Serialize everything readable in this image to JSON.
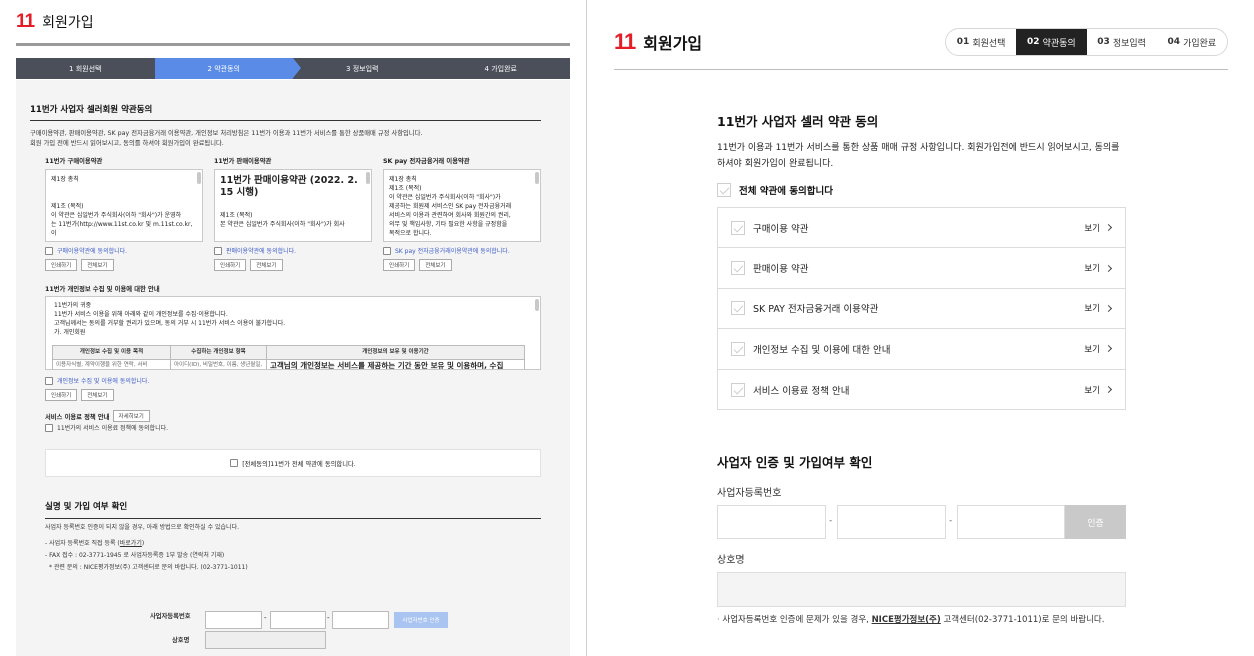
{
  "left": {
    "logo": "11",
    "title": "회원가입",
    "steps": [
      "1  회원선택",
      "2  약관동의",
      "3  정보입력",
      "4  가입완료"
    ],
    "section_title": "11번가 사업자 셀러회원 약관동의",
    "intro1": "구매이용약관, 판매이용약관, SK pay 전자금융거래 이용약관, 개인정보 처리방침은 11번가 이용과 11번가 서비스를 통한 상품매매 규정 사항입니다.",
    "intro2": "회원 가입 전에 반드시 읽어보시고, 동의를 하셔야 회원가입이 완료됩니다.",
    "terms": [
      {
        "title": "11번가 구매이용약관",
        "l1": "제1장 총칙",
        "l2": "",
        "l3": "제1조 (목적)",
        "l4": "이 약관은 십일번가 주식회사(이하 \"회사\")가 운영하",
        "l5": "는 11번가(http://www.11st.co.kr 및 m.11st.co.kr, 이",
        "chk": "구매이용약관에 동의합니다."
      },
      {
        "title": "11번가 판매이용약관",
        "big": "11번가 판매이용약관 (2022. 2. 15 시행)",
        "l3": "제1조 (목적)",
        "l4": "본 약관은 십일번가 주식회사(이하 \"회사\")가 회사",
        "chk": "판매이용약관에 동의합니다."
      },
      {
        "title": "SK pay 전자금융거래 이용약관",
        "l1": "제1장 총칙",
        "l2": "제1조 (목적)",
        "l3": "이 약관은 십일번가 주식회사(이하 \"회사\")가",
        "l4": "제공하는 회원제 서비스인 SK pay 전자금융거래",
        "l5": "서비스의 이용과 관련하여 회사와 회원간의 권리,",
        "l6": "의무 및 책임사항, 기타 필요한 사항을 규정함을",
        "l7": "목적으로 합니다.",
        "chk": "SK pay 전자금융거래이용약관에 동의합니다."
      }
    ],
    "btn_print": "인쇄하기",
    "btn_full": "전체보기",
    "priv_title": "11번가 개인정보 수집 및 이용에 대한 안내",
    "priv_l1": "11번가의 귀중",
    "priv_l2": "11번가 서비스 이용을 위해 아래와 같이 개인정보를 수집·이용합니다.",
    "priv_l3": "고객님께서는 동의를 거부할 권리가 있으며, 동의 거부 시 11번가 서비스 이용이 불가합니다.",
    "priv_l4": "가. 개인회원",
    "priv_cols": [
      "개인정보 수집 및 이용 목적",
      "수집하는 개인정보 항목",
      "개인정보의 보유 및 이용기간"
    ],
    "priv_row": [
      "이용자식별, 계약이행을 위한 연락, 서비",
      "아이디(ID), 비밀번호, 이름, 생년월일, ",
      "고객님의 개인정보는 서비스를 제공하는 기간 동안 보유 및 이용하며, 수집"
    ],
    "priv_chk": "개인정보 수집 및 이용에 동의합니다.",
    "svc_title": "서비스 이용료 정책 안내",
    "svc_btn": "자세히보기",
    "svc_chk": "11번가의 서비스 이용료 정책에 동의합니다.",
    "all_agree": "[전체동의]11번가 전체 약관에 동의합니다.",
    "verify_title": "실명 및 가입 여부 확인",
    "verify_l1": "사업자 등록번호 인증이 되지 않을 경우, 아래 방법으로 확인하실 수 있습니다.",
    "verify_l2": "- 사업자 등록번호 직접 등록 (",
    "verify_link": "바로가기",
    "verify_l3": "- FAX 접수 : 02-3771-1945 로 사업자등록증 1부 발송 (연락처 기재)",
    "verify_l4": "* 관련 문의 : NICE평가정보(주) 고객센터로 문의 바랍니다. (02-3771-1011)",
    "biz_label": "사업자등록번호",
    "biz_btn": "사업자번호 인증",
    "co_label": "상호명"
  },
  "right": {
    "logo": "11",
    "title": "회원가입",
    "steps": [
      {
        "num": "01",
        "label": "회원선택"
      },
      {
        "num": "02",
        "label": "약관동의"
      },
      {
        "num": "03",
        "label": "정보입력"
      },
      {
        "num": "04",
        "label": "가입완료"
      }
    ],
    "section_title": "11번가 사업자 셀러 약관 동의",
    "desc": "11번가 이용과 11번가 서비스를 통한 상품 매매 규정 사항입니다. 회원가입전에 반드시 읽어보시고, 동의를 하셔야 회원가입이 완료됩니다.",
    "all_agree": "전체 약관에 동의합니다",
    "items": [
      "구매이용 약관",
      "판매이용 약관",
      "SK PAY 전자금융거래 이용약관",
      "개인정보 수집 및 이용에 대한 안내",
      "서비스 이용료 정책 안내"
    ],
    "view": "보기",
    "biz_section": "사업자 인증 및 가입여부 확인",
    "biz_label": "사업자등록번호",
    "verify_btn": "인증",
    "co_label": "상호명",
    "note_pre": "사업자등록번호 인증에 문제가 있을 경우, ",
    "note_link": "NICE평가정보(주)",
    "note_post": " 고객센터(02-3771-1011)로 문의 바랍니다.",
    "accent": "#e31e26"
  }
}
